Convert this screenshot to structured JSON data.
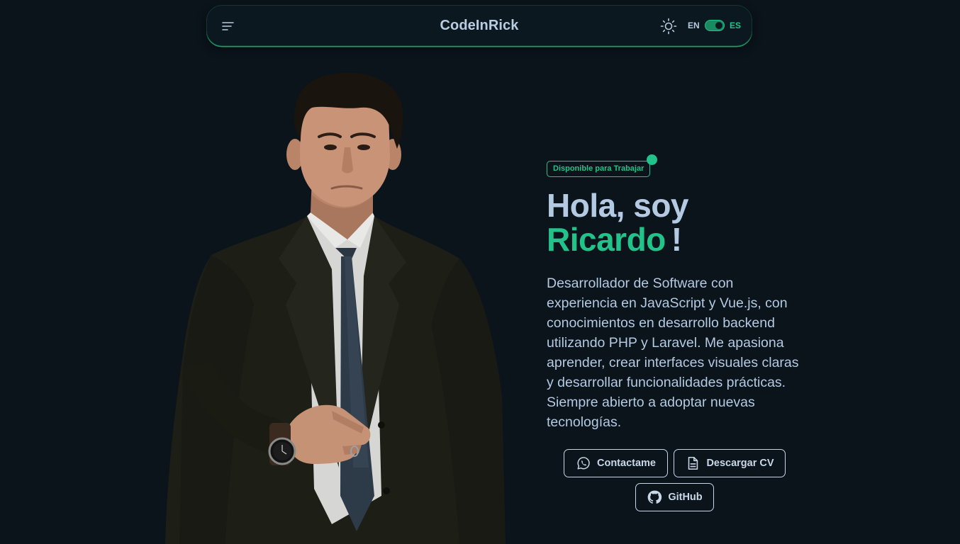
{
  "navbar": {
    "brand": "CodeInRick",
    "menu_icon": "menu-icon",
    "theme_icon": "sun-icon",
    "lang_en": "EN",
    "lang_es": "ES",
    "lang_selected": "ES",
    "accent_color": "#22c38a"
  },
  "hero": {
    "badge": "Disponible para Trabajar",
    "greeting": "Hola, soy",
    "name": "Ricardo",
    "exclamation": "!",
    "description": "Desarrollador de Software con experiencia en JavaScript y Vue.js, con conocimientos en desarrollo backend utilizando PHP y Laravel. Me apasiona aprender, crear interfaces visuales claras y desarrollar funcionalidades prácticas. Siempre abierto a adoptar nuevas tecnologías.",
    "buttons": {
      "contact": "Contactame",
      "cv": "Descargar CV",
      "github": "GitHub"
    }
  },
  "colors": {
    "background": "#0b131b",
    "text": "#b4cae2",
    "accent": "#22c38a"
  }
}
